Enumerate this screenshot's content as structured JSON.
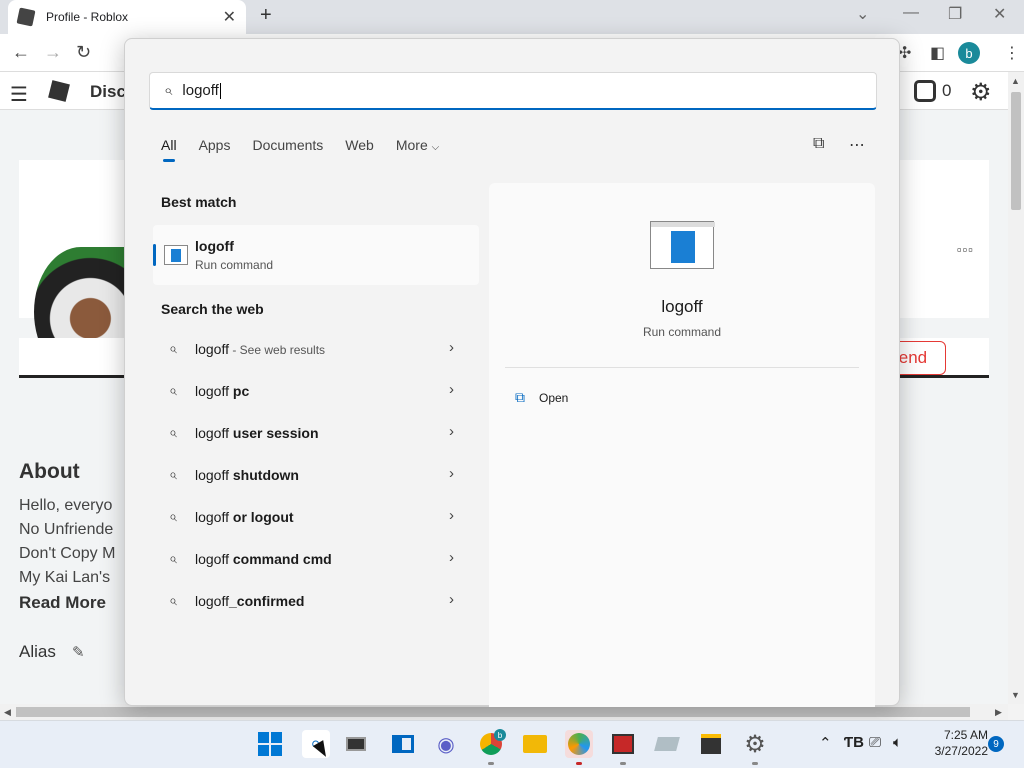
{
  "browser": {
    "tab_title": "Profile - Roblox",
    "tab_close": "✕",
    "new_tab": "+",
    "minimize": "—",
    "restore": "❐",
    "close": "✕",
    "dropdown": "⌄",
    "profile_initial": "b"
  },
  "page": {
    "nav_label": "Disco",
    "robux_count": "0",
    "friend_label": "iend",
    "about_title": "About",
    "about_lines": [
      "Hello, everyo",
      "No Unfriende",
      "Don't Copy M",
      "My Kai Lan's"
    ],
    "read_more": "Read More",
    "alias_label": "Alias"
  },
  "search": {
    "query": "logoff",
    "tabs": [
      "All",
      "Apps",
      "Documents",
      "Web",
      "More"
    ],
    "best_match_label": "Best match",
    "best_match": {
      "title": "logoff",
      "subtitle": "Run command"
    },
    "web_label": "Search the web",
    "web_results": [
      {
        "prefix": "logoff",
        "bold": "",
        "suffix": " - See web results"
      },
      {
        "prefix": "logoff",
        "bold": " pc",
        "suffix": ""
      },
      {
        "prefix": "logoff",
        "bold": " user session",
        "suffix": ""
      },
      {
        "prefix": "logoff",
        "bold": " shutdown",
        "suffix": ""
      },
      {
        "prefix": "logoff",
        "bold": " or logout",
        "suffix": ""
      },
      {
        "prefix": "logoff",
        "bold": " command cmd",
        "suffix": ""
      },
      {
        "prefix": "logoff",
        "bold": "_confirmed",
        "suffix": ""
      }
    ],
    "preview": {
      "title": "logoff",
      "subtitle": "Run command",
      "open_label": "Open"
    }
  },
  "taskbar": {
    "time": "7:25 AM",
    "date": "3/27/2022",
    "notifications": "9",
    "chrome_badge": "b"
  },
  "colors": {
    "accent": "#0067c0",
    "taskbar": "#e8eef7",
    "roblox_red": "#e53935"
  }
}
